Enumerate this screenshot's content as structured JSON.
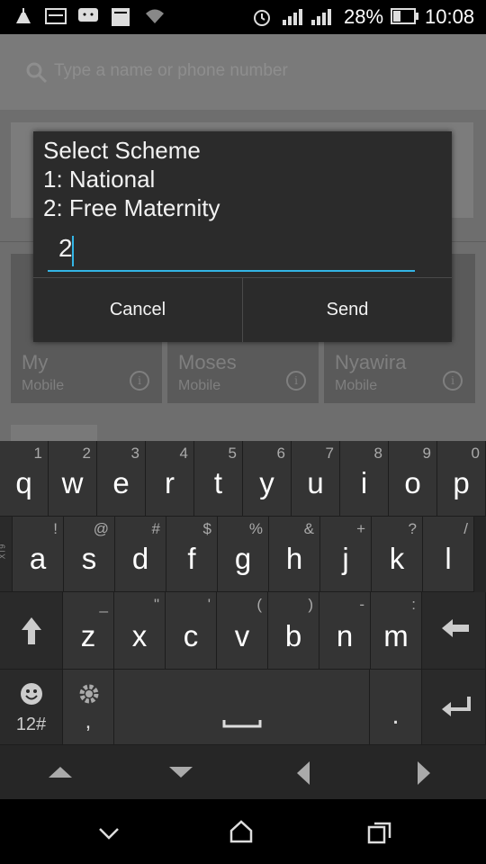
{
  "status_bar": {
    "battery": "28%",
    "time": "10:08"
  },
  "search": {
    "placeholder": "Type a name or phone number"
  },
  "contacts": [
    {
      "name": "My",
      "type": "Mobile"
    },
    {
      "name": "Moses",
      "type": "Mobile"
    },
    {
      "name": "Nyawira",
      "type": "Mobile"
    }
  ],
  "dialog": {
    "title": "Select Scheme",
    "option1": "1: National",
    "option2": "2: Free Maternity",
    "input_value": "2",
    "cancel": "Cancel",
    "send": "Send"
  },
  "keyboard": {
    "row1": [
      {
        "k": "q",
        "a": "1"
      },
      {
        "k": "w",
        "a": "2"
      },
      {
        "k": "e",
        "a": "3"
      },
      {
        "k": "r",
        "a": "4"
      },
      {
        "k": "t",
        "a": "5"
      },
      {
        "k": "y",
        "a": "6"
      },
      {
        "k": "u",
        "a": "7"
      },
      {
        "k": "i",
        "a": "8"
      },
      {
        "k": "o",
        "a": "9"
      },
      {
        "k": "p",
        "a": "0"
      }
    ],
    "row2": [
      {
        "k": "a",
        "a": "!"
      },
      {
        "k": "s",
        "a": "@"
      },
      {
        "k": "d",
        "a": "#"
      },
      {
        "k": "f",
        "a": "$"
      },
      {
        "k": "g",
        "a": "%"
      },
      {
        "k": "h",
        "a": "&"
      },
      {
        "k": "j",
        "a": "+"
      },
      {
        "k": "k",
        "a": "?"
      },
      {
        "k": "l",
        "a": "/"
      }
    ],
    "row3": [
      {
        "k": "z",
        "a": "_"
      },
      {
        "k": "x",
        "a": "\""
      },
      {
        "k": "c",
        "a": "'"
      },
      {
        "k": "v",
        "a": "("
      },
      {
        "k": "b",
        "a": ")"
      },
      {
        "k": "n",
        "a": "-"
      },
      {
        "k": "m",
        "a": ":"
      }
    ],
    "mode_key": "12#",
    "comma": ",",
    "period": ".",
    "side_label": "XT9"
  },
  "colors": {
    "accent": "#33b5e5",
    "key": "#343434",
    "dialog": "#2b2b2b"
  }
}
